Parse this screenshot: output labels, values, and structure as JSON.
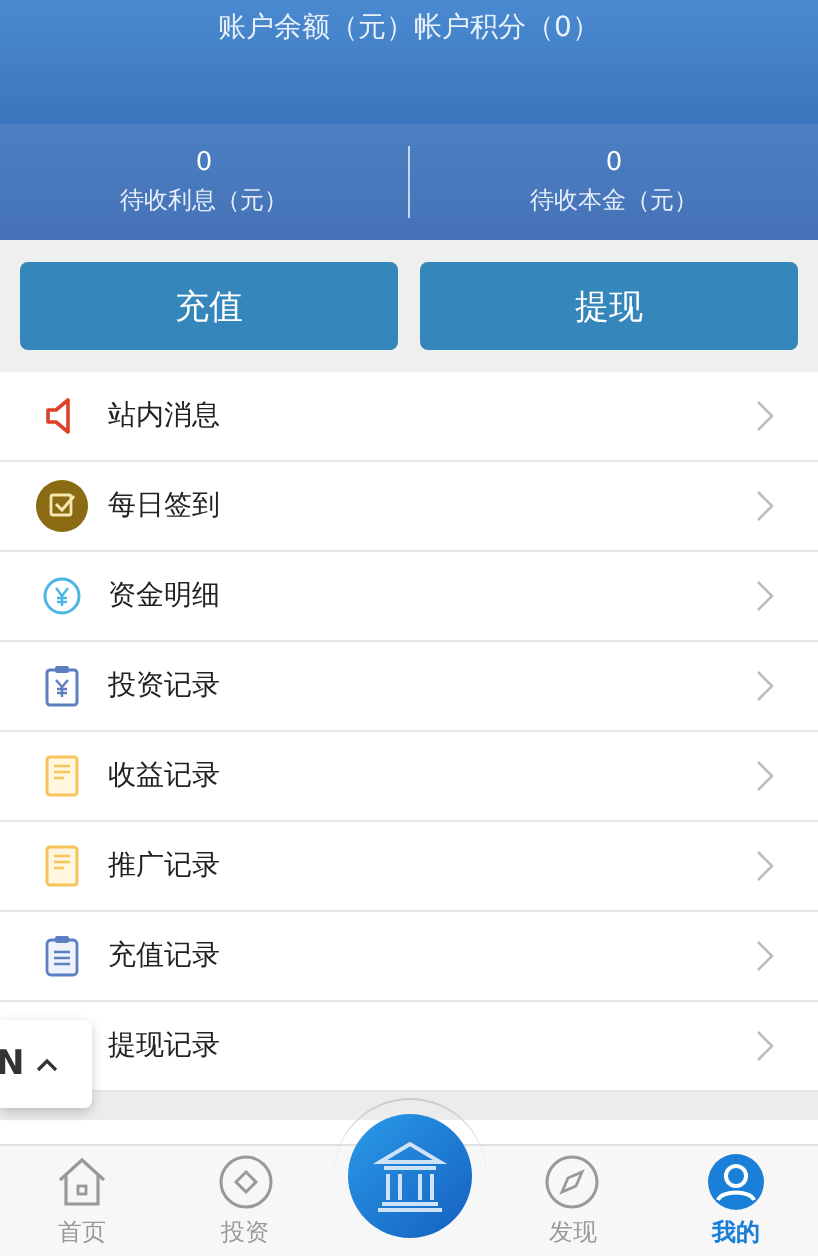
{
  "header": {
    "title": "账户余额（元）帐户积分（0）"
  },
  "stats": [
    {
      "value": "0",
      "label": "待收利息（元）"
    },
    {
      "value": "0",
      "label": "待收本金（元）"
    }
  ],
  "actions": [
    "充值",
    "提现"
  ],
  "menu": [
    {
      "label": "站内消息"
    },
    {
      "label": "每日签到"
    },
    {
      "label": "资金明细"
    },
    {
      "label": "投资记录"
    },
    {
      "label": "收益记录"
    },
    {
      "label": "推广记录"
    },
    {
      "label": "充值记录"
    },
    {
      "label": "提现记录"
    }
  ],
  "floating_chip": {
    "text": "N"
  },
  "tabs": [
    {
      "label": "首页",
      "selected": false
    },
    {
      "label": "投资",
      "selected": false
    },
    {
      "label": "发现",
      "selected": false
    },
    {
      "label": "我的",
      "selected": true
    }
  ]
}
